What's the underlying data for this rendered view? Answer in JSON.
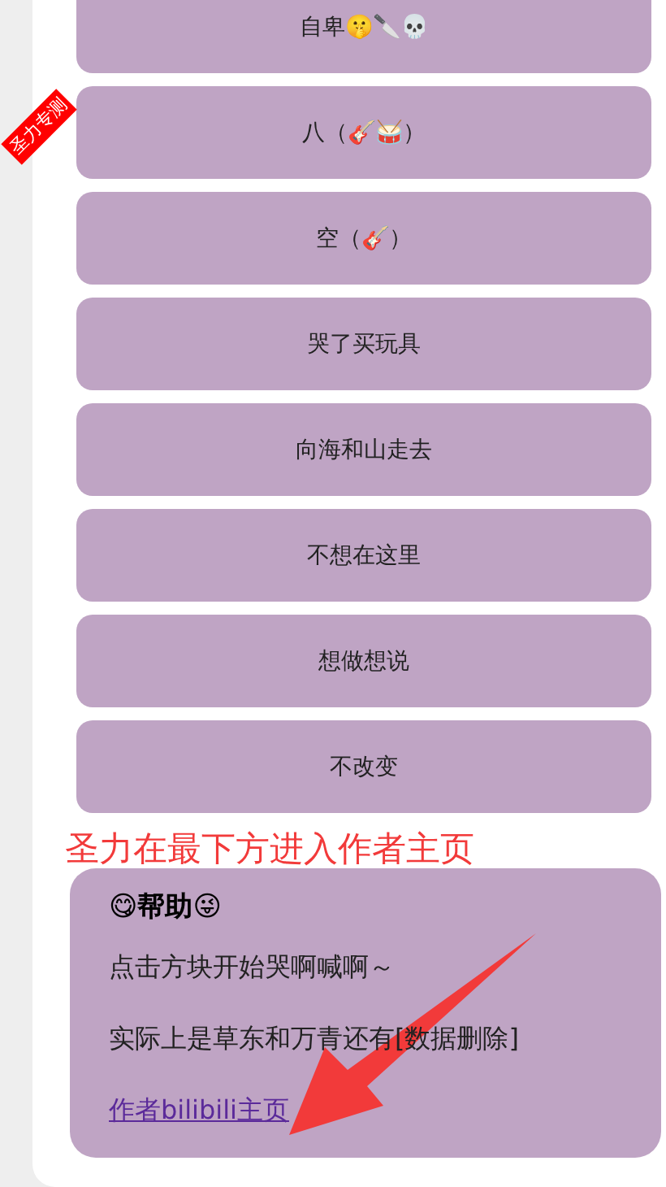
{
  "ribbon": {
    "text": "圣力专测"
  },
  "songs": [
    {
      "label": "自卑🤫🔪💀"
    },
    {
      "label": "八（🎸🥁）"
    },
    {
      "label": "空（🎸）"
    },
    {
      "label": "哭了买玩具"
    },
    {
      "label": "向海和山走去"
    },
    {
      "label": "不想在这里"
    },
    {
      "label": "想做想说"
    },
    {
      "label": "不改变"
    }
  ],
  "annotation": {
    "text": "圣力在最下方进入作者主页"
  },
  "help": {
    "title": "😋帮助😜",
    "paragraphs": [
      "点击方块开始哭啊喊啊～",
      "实际上是草东和万青还有[数据删除]"
    ],
    "link": "作者bilibili主页"
  }
}
